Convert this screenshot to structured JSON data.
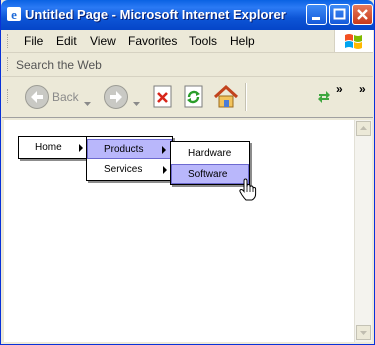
{
  "window": {
    "title": "Untitled Page - Microsoft Internet Explorer"
  },
  "menubar": {
    "items": [
      "File",
      "Edit",
      "View",
      "Favorites",
      "Tools",
      "Help"
    ]
  },
  "searchbar": {
    "placeholder": "Search the Web"
  },
  "toolbar": {
    "back_label": "Back"
  },
  "page_menu": {
    "level1": [
      {
        "label": "Home",
        "has_submenu": true
      }
    ],
    "level2": [
      {
        "label": "Products",
        "has_submenu": true,
        "active": true
      },
      {
        "label": "Services",
        "has_submenu": true,
        "active": false
      }
    ],
    "level3": [
      {
        "label": "Hardware",
        "active": false
      },
      {
        "label": "Software",
        "active": true
      }
    ]
  },
  "colors": {
    "menu_highlight": "#b9b7fb",
    "menu_highlight_border": "#6d6ad0",
    "titlebar": "#0d55d6"
  }
}
